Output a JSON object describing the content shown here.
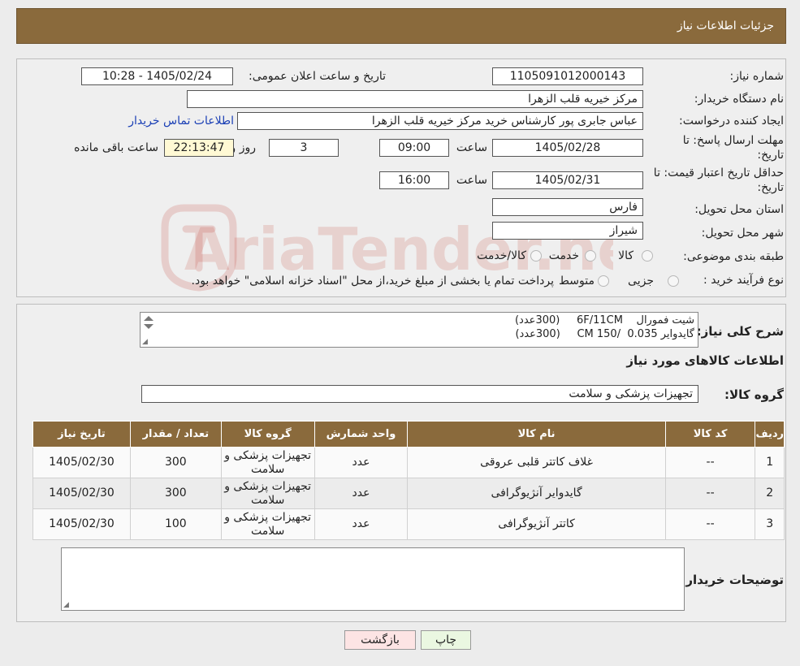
{
  "header": {
    "title": "جزئیات اطلاعات نیاز"
  },
  "form": {
    "need_number_label": "شماره نیاز:",
    "need_number": "1105091012000143",
    "announce_label": "تاریخ و ساعت اعلان عمومی:",
    "announce_value": "1405/02/24 - 10:28",
    "buyer_label": "نام دستگاه خریدار:",
    "buyer_value": "مرکز خیریه قلب الزهرا",
    "creator_label": "ایجاد کننده درخواست:",
    "creator_value": "عباس جابری پور کارشناس خرید مرکز خیریه قلب الزهرا",
    "contact_link": "اطلاعات تماس خریدار",
    "deadline_label_1": "مهلت ارسال پاسخ: تا",
    "deadline_label_2": "تاریخ:",
    "deadline_date": "1405/02/28",
    "time_label": "ساعت",
    "deadline_time": "09:00",
    "days_value": "3",
    "days_label": "روز و",
    "remaining_value": "22:13:47",
    "remaining_label": "ساعت باقی مانده",
    "validity_label_1": "حداقل تاریخ اعتبار قیمت: تا",
    "validity_label_2": "تاریخ:",
    "validity_date": "1405/02/31",
    "validity_time": "16:00",
    "province_label": "استان محل تحویل:",
    "province_value": "فارس",
    "city_label": "شهر محل تحویل:",
    "city_value": "شیراز",
    "category_label": "طبقه بندی موضوعی:",
    "category_options": [
      "کالا",
      "خدمت",
      "کالا/خدمت"
    ],
    "process_label": "نوع فرآیند خرید :",
    "process_options": [
      "جزیی",
      "متوسط"
    ],
    "process_note": "پرداخت تمام یا بخشی از مبلغ خرید،از محل \"اسناد خزانه اسلامی\" خواهد بود."
  },
  "description": {
    "label": "شرح کلی نیاز:",
    "lines": [
      "شیت فمورال    6F/11CM     (300عدد)",
      "گایدوایر 0.035  /150 CM     (300عدد)"
    ]
  },
  "goods": {
    "section_title": "اطلاعات کالاهای مورد نیاز",
    "group_label": "گروه کالا:",
    "group_value": "تجهیزات پزشکی و سلامت",
    "columns": [
      "ردیف",
      "کد کالا",
      "نام کالا",
      "واحد شمارش",
      "گروه کالا",
      "تعداد / مقدار",
      "تاریخ نیاز"
    ],
    "rows": [
      [
        "1",
        "--",
        "غلاف کاتتر قلبی عروقی",
        "عدد",
        "تجهیزات پزشکی و سلامت",
        "300",
        "1405/02/30"
      ],
      [
        "2",
        "--",
        "گایدوایر آنژیوگرافی",
        "عدد",
        "تجهیزات پزشکی و سلامت",
        "300",
        "1405/02/30"
      ],
      [
        "3",
        "--",
        "کاتتر آنژیوگرافی",
        "عدد",
        "تجهیزات پزشکی و سلامت",
        "100",
        "1405/02/30"
      ]
    ]
  },
  "buyer_notes": {
    "label": "توضیحات خریدار:",
    "value": ""
  },
  "buttons": {
    "print": "چاپ",
    "back": "بازگشت"
  },
  "watermark": {
    "text": "AriaTender.neT"
  },
  "colors": {
    "header_bg": "#8a6a3c",
    "link": "#1a3fb5",
    "remaining_bg": "#fff9d4",
    "back_btn_bg": "#fde4e4",
    "print_btn_bg": "#eaf7e1"
  },
  "icons": {
    "scroll": "scroll-arrows-icon",
    "resize": "resize-grip-icon"
  }
}
